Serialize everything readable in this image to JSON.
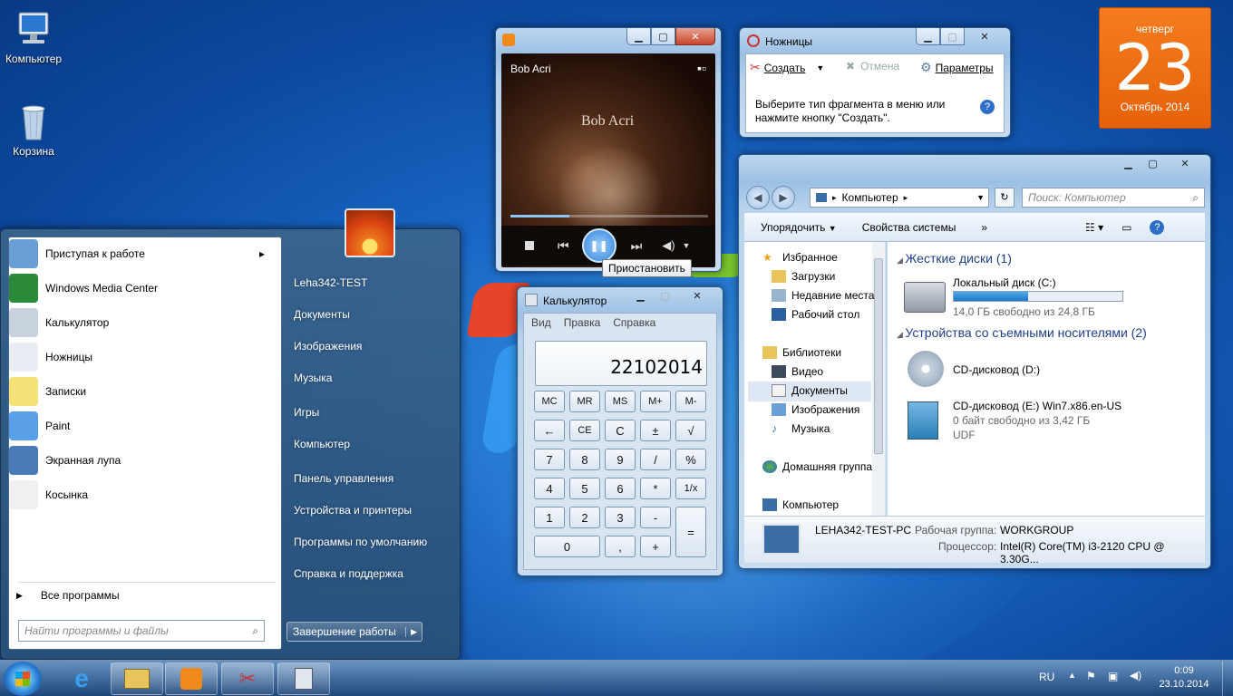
{
  "desktop": {
    "icons": [
      {
        "label": "Компьютер"
      },
      {
        "label": "Корзина"
      }
    ]
  },
  "calendar_gadget": {
    "weekday": "четверг",
    "day": "23",
    "month_year": "Октябрь 2014"
  },
  "media_player": {
    "track": "Bob Acri",
    "album_art_title": "Bob Acri",
    "progress": 0.3,
    "tooltip": "Приостановить"
  },
  "snipping_tool": {
    "title": "Ножницы",
    "new_label": "Создать",
    "cancel_label": "Отмена",
    "options_label": "Параметры",
    "hint": "Выберите тип фрагмента в меню или нажмите кнопку \"Создать\"."
  },
  "calculator": {
    "title": "Калькулятор",
    "menu": [
      "Вид",
      "Правка",
      "Справка"
    ],
    "display": "22102014",
    "rows": [
      [
        "MC",
        "MR",
        "MS",
        "M+",
        "M-"
      ],
      [
        "←",
        "CE",
        "C",
        "±",
        "√"
      ],
      [
        "7",
        "8",
        "9",
        "/",
        "%"
      ],
      [
        "4",
        "5",
        "6",
        "*",
        "1/x"
      ],
      [
        "1",
        "2",
        "3",
        "-",
        "="
      ],
      [
        "0",
        ",",
        "+"
      ]
    ]
  },
  "explorer": {
    "address_root": "Компьютер",
    "search_placeholder": "Поиск: Компьютер",
    "toolbar": {
      "organize": "Упорядочить",
      "system_props": "Свойства системы",
      "more": "»"
    },
    "nav": [
      {
        "label": "Избранное"
      },
      {
        "label": "Загрузки"
      },
      {
        "label": "Недавние места"
      },
      {
        "label": "Рабочий стол"
      },
      {
        "label": "Библиотеки"
      },
      {
        "label": "Видео"
      },
      {
        "label": "Документы"
      },
      {
        "label": "Изображения"
      },
      {
        "label": "Музыка"
      },
      {
        "label": "Домашняя группа"
      },
      {
        "label": "Компьютер"
      }
    ],
    "hdd_group": "Жесткие диски (1)",
    "local_disk": {
      "name": "Локальный диск (C:)",
      "free": "14,0 ГБ свободно из 24,8 ГБ",
      "used_fraction": 0.44
    },
    "removable_group": "Устройства со съемными носителями (2)",
    "cd_d": {
      "name": "CD-дисковод (D:)"
    },
    "cd_e": {
      "name": "CD-дисковод (E:) Win7.x86.en-US",
      "free": "0 байт свободно из 3,42 ГБ",
      "fs": "UDF"
    },
    "details": {
      "pc_name": "LEHA342-TEST-PC",
      "workgroup_label": "Рабочая группа:",
      "workgroup": "WORKGROUP",
      "cpu_label": "Процессор:",
      "cpu": "Intel(R) Core(TM) i3-2120 CPU @ 3.30G..."
    }
  },
  "start_menu": {
    "left_items": [
      {
        "label": "Приступая к работе"
      },
      {
        "label": "Windows Media Center"
      },
      {
        "label": "Калькулятор"
      },
      {
        "label": "Ножницы"
      },
      {
        "label": "Записки"
      },
      {
        "label": "Paint"
      },
      {
        "label": "Экранная лупа"
      },
      {
        "label": "Косынка"
      }
    ],
    "all_programs": "Все программы",
    "search_placeholder": "Найти программы и файлы",
    "right_items": [
      {
        "label": "Leha342-TEST"
      },
      {
        "label": "Документы"
      },
      {
        "label": "Изображения"
      },
      {
        "label": "Музыка"
      },
      {
        "label": "Игры"
      },
      {
        "label": "Компьютер"
      },
      {
        "label": "Панель управления"
      },
      {
        "label": "Устройства и принтеры"
      },
      {
        "label": "Программы по умолчанию"
      },
      {
        "label": "Справка и поддержка"
      }
    ],
    "shutdown": "Завершение работы"
  },
  "taskbar": {
    "lang": "RU",
    "time": "0:09",
    "date": "23.10.2014"
  }
}
